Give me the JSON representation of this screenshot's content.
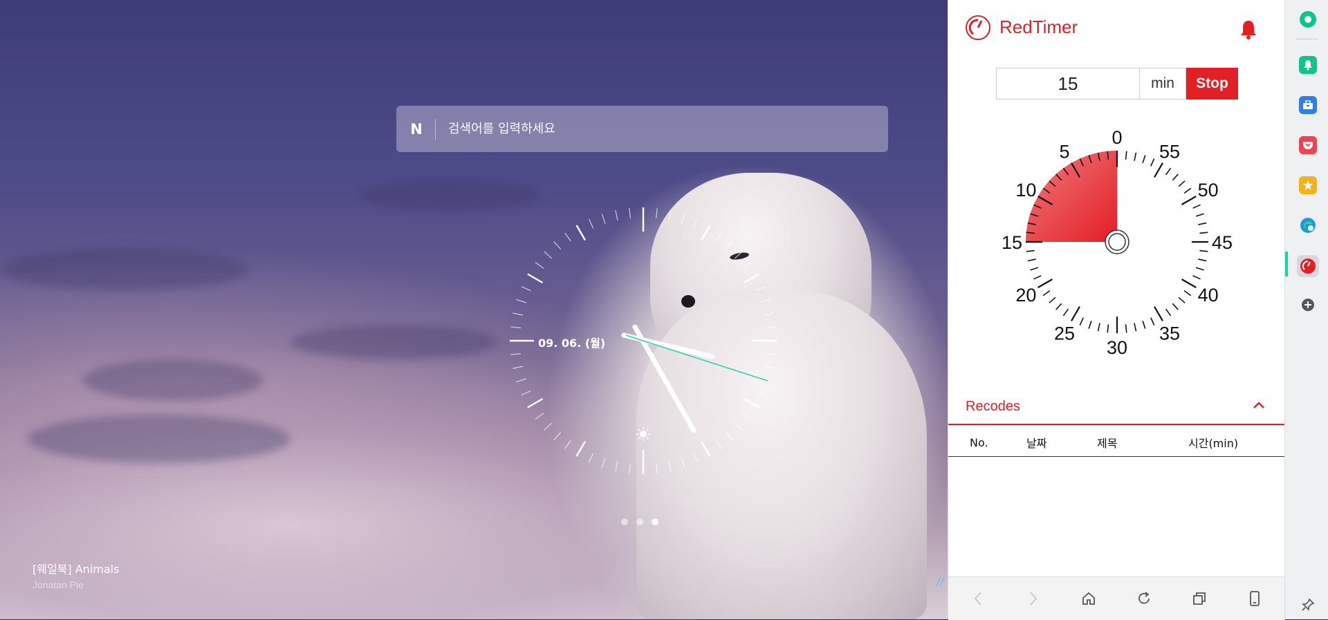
{
  "search": {
    "placeholder": "검색어를 입력하세요",
    "logo": "N"
  },
  "clock": {
    "date": "09. 06. (월)"
  },
  "wallpaper": {
    "title": "[웨일북] Animals",
    "author": "Jonatan Pie",
    "pages": 3,
    "active_page": 3
  },
  "timer": {
    "app_title": "RedTimer",
    "minutes_value": "15",
    "unit_label": "min",
    "stop_label": "Stop",
    "dial_labels": [
      "0",
      "5",
      "10",
      "15",
      "20",
      "25",
      "30",
      "35",
      "40",
      "45",
      "50",
      "55"
    ],
    "remaining_minutes": 15,
    "accent": "#e31e24"
  },
  "records": {
    "title": "Recodes",
    "columns": [
      "No.",
      "날짜",
      "제목",
      "시간(min)"
    ],
    "rows": []
  },
  "footer_icons": [
    "back-icon",
    "forward-icon",
    "home-icon",
    "reload-icon",
    "tabs-icon",
    "mobile-icon"
  ],
  "dock_icons": [
    "whale-icon",
    "notification-icon",
    "tools-icon",
    "pocket-icon",
    "favorites-icon",
    "edge-icon",
    "redtimer-icon",
    "add-icon",
    "pin-icon"
  ]
}
